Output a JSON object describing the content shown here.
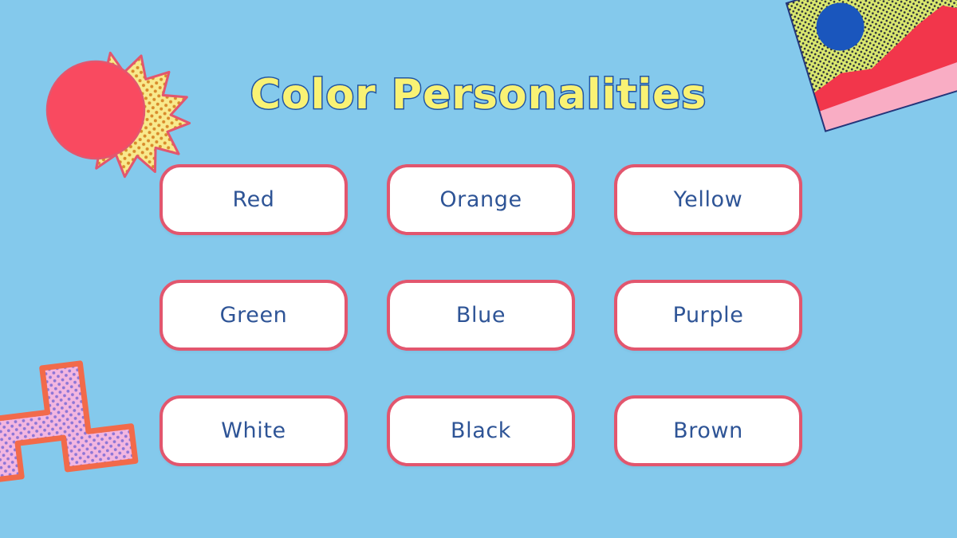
{
  "slide": {
    "title": "Color Personalities",
    "background_color": "#84c9ec",
    "title_fill_color": "#f9f274",
    "title_outline_color": "#2156a5"
  },
  "grid": {
    "rows": 3,
    "columns": 3,
    "button_fill_color": "#ffffff",
    "button_border_color": "#e2566e",
    "button_text_color": "#2e5496",
    "items": [
      {
        "label": "Red"
      },
      {
        "label": "Orange"
      },
      {
        "label": "Yellow"
      },
      {
        "label": "Green"
      },
      {
        "label": "Blue"
      },
      {
        "label": "Purple"
      },
      {
        "label": "White"
      },
      {
        "label": "Black"
      },
      {
        "label": "Brown"
      }
    ]
  },
  "decorations": {
    "sun": {
      "name": "sun-burst-decoration",
      "ray_fill_color": "#f8e98c",
      "ray_dot_color": "#d98b2b",
      "outline_color": "#e2566e",
      "core_color": "#f94a60",
      "spike_count": 14
    },
    "zigzag": {
      "name": "zigzag-lightning-decoration",
      "fill_color": "#f3b6e0",
      "dot_color": "#8e76d6",
      "outline_color": "#f26a4a"
    },
    "postcard": {
      "name": "landscape-postcard-decoration",
      "border_color": "#23357a",
      "sky_color": "#dbe96f",
      "sky_dot_color": "#2b2f3a",
      "sun_circle_color": "#1a56bd",
      "mountain_color": "#f2364b",
      "foreground_color": "#f9adc4",
      "rotation_degrees": -17
    }
  }
}
